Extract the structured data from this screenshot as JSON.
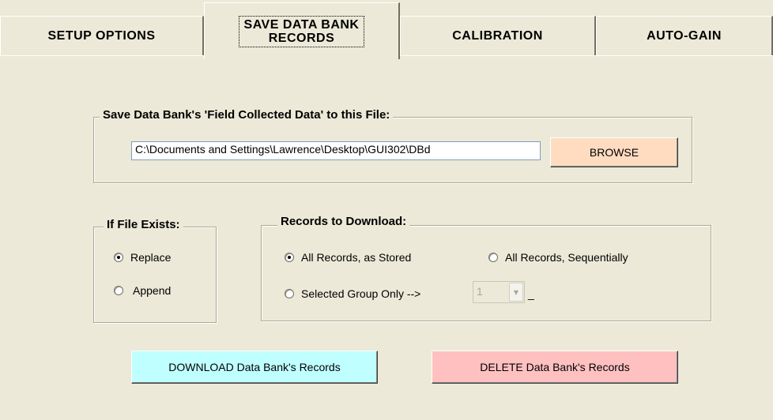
{
  "tabs": [
    {
      "label": "SETUP  OPTIONS"
    },
    {
      "label_line1": "SAVE DATA BANK",
      "label_line2": "RECORDS"
    },
    {
      "label": "CALIBRATION"
    },
    {
      "label": "AUTO-GAIN"
    }
  ],
  "save_file": {
    "legend": "Save Data Bank's 'Field Collected Data' to this File:",
    "path": "C:\\Documents and Settings\\Lawrence\\Desktop\\GUI302\\DBd",
    "browse_label": "BROWSE"
  },
  "file_exists": {
    "legend": "If File Exists:",
    "options": [
      {
        "label": "Replace",
        "checked": true
      },
      {
        "label": "Append",
        "checked": false
      }
    ]
  },
  "records": {
    "legend": "Records to Download:",
    "options": [
      {
        "label": "All Records, as Stored",
        "checked": true
      },
      {
        "label": "All Records, Sequentially",
        "checked": false
      },
      {
        "label": "Selected Group Only -->",
        "checked": false
      }
    ],
    "group_value": "1",
    "suffix": "_"
  },
  "actions": {
    "download_label": "DOWNLOAD Data Bank's Records",
    "download_color": "#c0ffff",
    "delete_label": "DELETE Data Bank's Records",
    "delete_color": "#ffc0c0",
    "browse_color": "#ffdcc0"
  }
}
